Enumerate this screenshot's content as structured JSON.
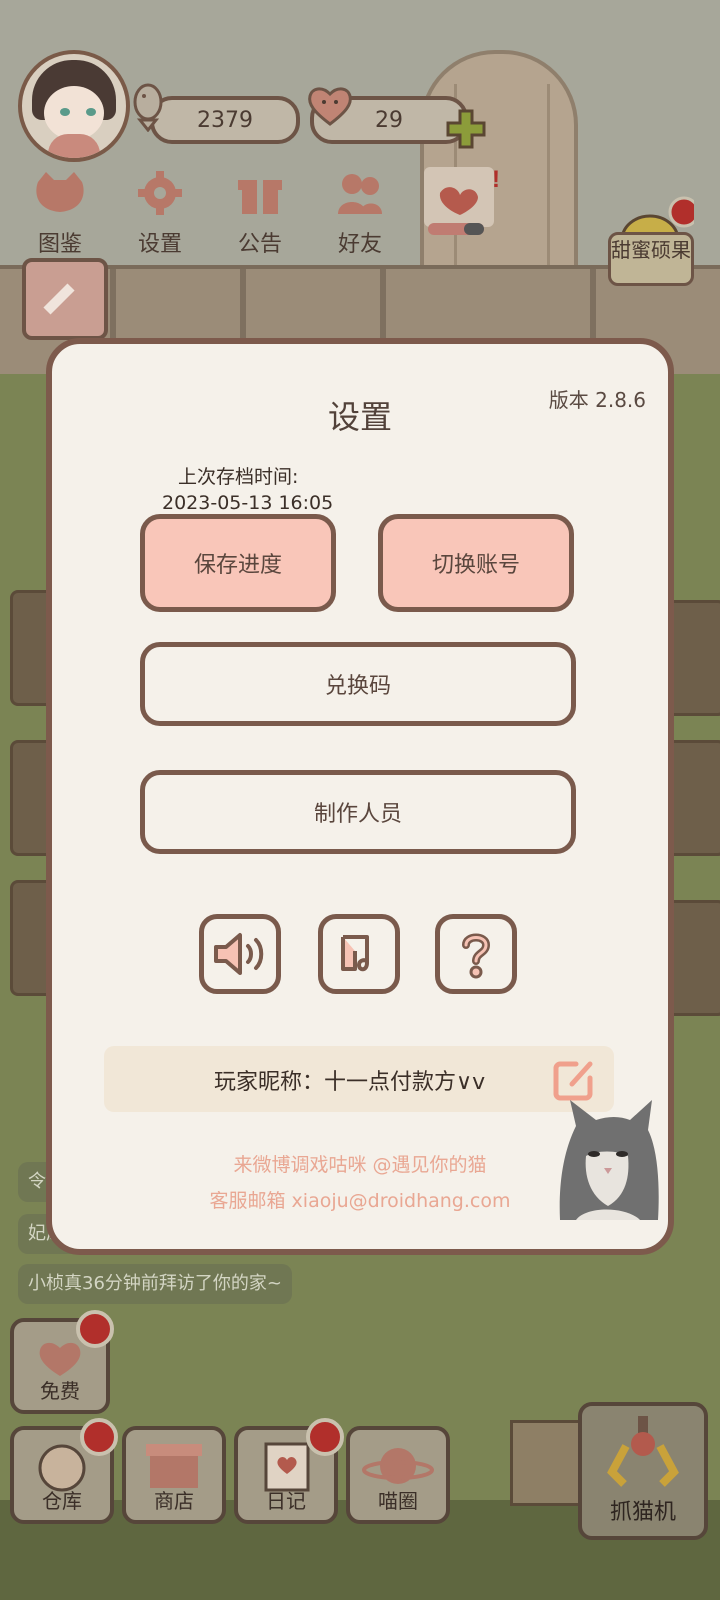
{
  "hud": {
    "fish_count": "2379",
    "heart_count": "29",
    "menu": [
      {
        "label": "图鉴",
        "icon": "cat-head-icon"
      },
      {
        "label": "设置",
        "icon": "gear-icon"
      },
      {
        "label": "公告",
        "icon": "gift-icon"
      },
      {
        "label": "好友",
        "icon": "friends-icon"
      }
    ],
    "candy_label": "甜蜜硕果"
  },
  "chat": [
    "令",
    "妃凤舞赠送给了你粑粑糖",
    "小桢真36分钟前拜访了你的家~"
  ],
  "bottom": {
    "free_label": "免费",
    "buttons": [
      "仓库",
      "商店",
      "日记",
      "喵圈"
    ],
    "claw_label": "抓猫机"
  },
  "settings": {
    "title": "设置",
    "version": "版本 2.8.6",
    "last_save_label": "上次存档时间:",
    "last_save_time": "2023-05-13 16:05",
    "save_button": "保存进度",
    "switch_account_button": "切换账号",
    "redeem_code_button": "兑换码",
    "credits_button": "制作人员",
    "icons": [
      "speaker-icon",
      "music-note-icon",
      "question-icon"
    ],
    "nickname_label": "玩家昵称：",
    "nickname_value": "十一点付款方∨v",
    "weibo_line": "来微博调戏咕咪 @遇见你的猫",
    "email_line": "客服邮箱 xiaoju@droidhang.com"
  },
  "colors": {
    "dialog_bg": "#f5f1ea",
    "dialog_border": "#7d5a4c",
    "pink_button": "#f9c6b9",
    "footer_text": "#e9a793"
  }
}
